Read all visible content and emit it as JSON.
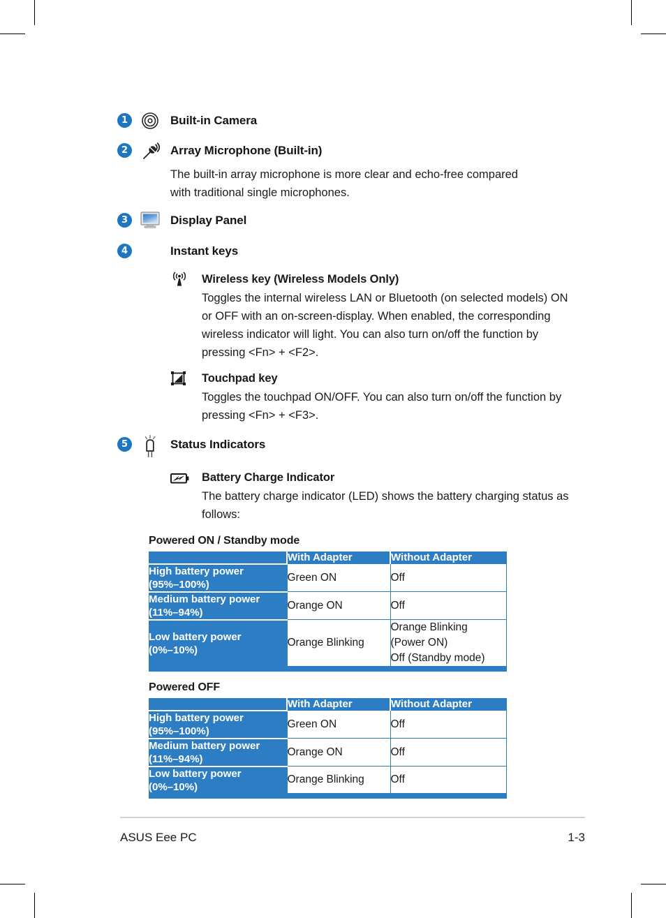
{
  "document": {
    "footer_left": "ASUS Eee PC",
    "footer_page": "1-3"
  },
  "colors": {
    "accent_blue": "#2d7dc4",
    "badge_blue": "#1f76c0"
  },
  "entries": [
    {
      "number": "1",
      "icon": "camera-icon",
      "title": "Built-in Camera",
      "body": ""
    },
    {
      "number": "2",
      "icon": "microphone-icon",
      "title": "Array Microphone (Built-in)",
      "body": "The built-in array microphone is more clear and echo-free compared with traditional single microphones."
    },
    {
      "number": "3",
      "icon": "display-panel-icon",
      "title": "Display Panel",
      "body": ""
    },
    {
      "number": "4",
      "icon": "",
      "title": "Instant keys",
      "body": ""
    },
    {
      "number": "5",
      "icon": "led-indicator-icon",
      "title": "Status Indicators",
      "body": ""
    }
  ],
  "instant_keys": [
    {
      "icon": "wireless-icon",
      "title": "Wireless key (Wireless Models Only)",
      "body": "Toggles the internal wireless LAN or Bluetooth (on selected models) ON or OFF with an on-screen-display. When enabled, the corresponding wireless indicator will light.  You can also turn on/off the function by pressing <Fn> + <F2>."
    },
    {
      "icon": "touchpad-icon",
      "title": "Touchpad key",
      "body": "Toggles the touchpad ON/OFF. You can also turn on/off the function by pressing <Fn> + <F3>."
    }
  ],
  "status_indicators": {
    "battery": {
      "icon": "battery-charge-icon",
      "title": "Battery Charge Indicator",
      "body": "The battery charge indicator (LED) shows the battery charging status as follows:"
    }
  },
  "tables": [
    {
      "heading": "Powered ON / Standby mode",
      "columns": [
        "",
        "With Adapter",
        "Without Adapter"
      ],
      "rows": [
        {
          "label_line1": "High battery power",
          "label_line2": "(95%–100%)",
          "with_adapter": "Green ON",
          "without_adapter": "Off"
        },
        {
          "label_line1": "Medium battery power",
          "label_line2": "(11%–94%)",
          "with_adapter": "Orange ON",
          "without_adapter": "Off"
        },
        {
          "label_line1": "Low battery power",
          "label_line2": "(0%–10%)",
          "with_adapter": "Orange Blinking",
          "without_adapter": "Orange Blinking\n(Power ON)\nOff (Standby mode)"
        }
      ]
    },
    {
      "heading": "Powered OFF",
      "columns": [
        "",
        "With Adapter",
        "Without Adapter"
      ],
      "rows": [
        {
          "label_line1": "High battery power",
          "label_line2": "(95%–100%)",
          "with_adapter": "Green ON",
          "without_adapter": "Off"
        },
        {
          "label_line1": "Medium battery power",
          "label_line2": "(11%–94%)",
          "with_adapter": "Orange ON",
          "without_adapter": "Off"
        },
        {
          "label_line1": "Low battery power",
          "label_line2": "(0%–10%)",
          "with_adapter": "Orange Blinking",
          "without_adapter": "Off"
        }
      ]
    }
  ]
}
